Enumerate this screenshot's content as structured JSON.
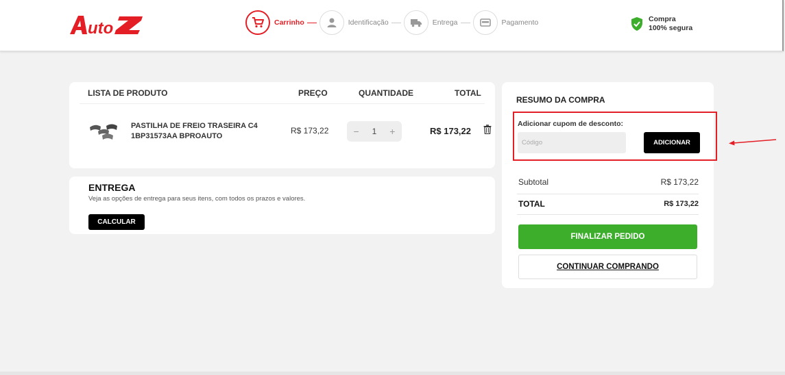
{
  "brand": {
    "logo_text": "AutoZ",
    "primary_color": "#e31e24"
  },
  "steps": [
    {
      "label": "Carrinho",
      "icon": "cart-icon",
      "active": true
    },
    {
      "label": "Identificação",
      "icon": "user-icon",
      "active": false
    },
    {
      "label": "Entrega",
      "icon": "truck-icon",
      "active": false
    },
    {
      "label": "Pagamento",
      "icon": "card-icon",
      "active": false
    }
  ],
  "secure": {
    "line1": "Compra",
    "line2": "100% segura",
    "icon": "shield-check-icon"
  },
  "product_list": {
    "headers": {
      "product": "LISTA DE PRODUTO",
      "price": "PREÇO",
      "quantity": "QUANTIDADE",
      "total": "TOTAL"
    },
    "items": [
      {
        "name": "PASTILHA DE FREIO TRASEIRA C4 1BP31573AA BPROAUTO",
        "price": "R$ 173,22",
        "quantity": "1",
        "total": "R$ 173,22",
        "minus": "−",
        "plus": "+"
      }
    ]
  },
  "entrega": {
    "title": "ENTREGA",
    "description": "Veja as opções de entrega para seus itens, com todos os prazos e valores.",
    "button": "CALCULAR"
  },
  "summary": {
    "title": "RESUMO DA COMPRA",
    "coupon": {
      "label": "Adicionar cupom de desconto:",
      "placeholder": "Código",
      "value": "",
      "button": "ADICIONAR"
    },
    "subtotal_label": "Subtotal",
    "subtotal_value": "R$ 173,22",
    "total_label": "TOTAL",
    "total_value": "R$ 173,22",
    "finalize_button": "FINALIZAR PEDIDO",
    "continue_button": "CONTINUAR COMPRANDO"
  },
  "colors": {
    "finalize": "#3dae2b",
    "highlight": "#e31e24"
  }
}
